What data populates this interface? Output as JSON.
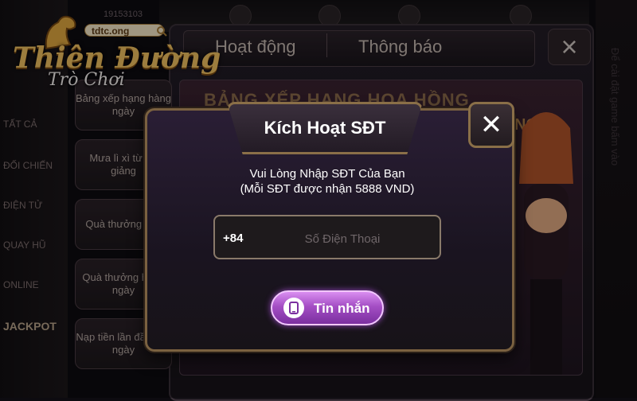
{
  "logo": {
    "domain": "tdtc.ong",
    "main": "Thiên Đường",
    "sub": "Trò Chơi"
  },
  "header": {
    "user_id": "19153103"
  },
  "left_menu": {
    "items": [
      "TẤT CẢ",
      "ĐỐI CHIẾN",
      "ĐIỆN TỬ",
      "QUAY HŨ",
      "ONLINE",
      "JACKPOT"
    ]
  },
  "panel": {
    "tabs": [
      "Hoạt động",
      "Thông báo"
    ],
    "close_icon": "close-icon",
    "menu": [
      "Bảng xếp hạng hàng ngày",
      "Mưa lì xì từ sứ giảng",
      "Quà thưởng VIP",
      "Quà thưởng hàng ngày",
      "Nạp tiền lần đầu mỗi ngày"
    ],
    "banner": "BẢNG XẾP HẠNG HOA HỒNG",
    "banner_suffix": "NGÀY",
    "side_text": "Để cài đặt game bấm vào"
  },
  "modal": {
    "title": "Kích Hoạt SĐT",
    "line1": "Vui Lòng Nhập SĐT Của Bạn",
    "line2": "(Mỗi SĐT được nhận 5888 VND)",
    "prefix": "+84",
    "placeholder": "Số Điện Thoại",
    "button_label": "Tin nhắn",
    "close_symbol": "✕"
  },
  "colors": {
    "accent": "#a44ec4",
    "gold": "#8a6f48"
  }
}
